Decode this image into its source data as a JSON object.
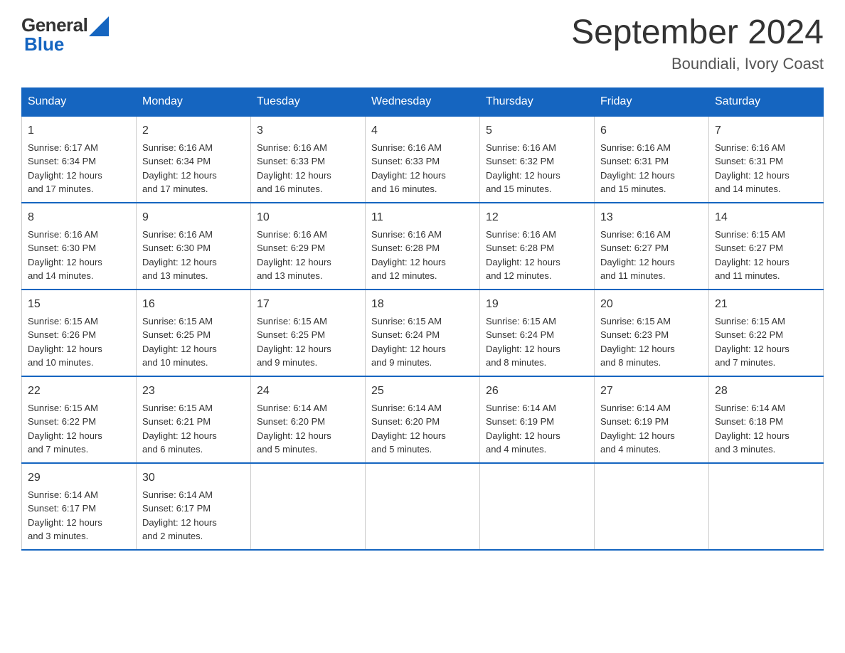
{
  "logo": {
    "general": "General",
    "blue": "Blue"
  },
  "title": "September 2024",
  "subtitle": "Boundiali, Ivory Coast",
  "days": [
    "Sunday",
    "Monday",
    "Tuesday",
    "Wednesday",
    "Thursday",
    "Friday",
    "Saturday"
  ],
  "weeks": [
    [
      {
        "day": "1",
        "sunrise": "6:17 AM",
        "sunset": "6:34 PM",
        "daylight": "12 hours and 17 minutes."
      },
      {
        "day": "2",
        "sunrise": "6:16 AM",
        "sunset": "6:34 PM",
        "daylight": "12 hours and 17 minutes."
      },
      {
        "day": "3",
        "sunrise": "6:16 AM",
        "sunset": "6:33 PM",
        "daylight": "12 hours and 16 minutes."
      },
      {
        "day": "4",
        "sunrise": "6:16 AM",
        "sunset": "6:33 PM",
        "daylight": "12 hours and 16 minutes."
      },
      {
        "day": "5",
        "sunrise": "6:16 AM",
        "sunset": "6:32 PM",
        "daylight": "12 hours and 15 minutes."
      },
      {
        "day": "6",
        "sunrise": "6:16 AM",
        "sunset": "6:31 PM",
        "daylight": "12 hours and 15 minutes."
      },
      {
        "day": "7",
        "sunrise": "6:16 AM",
        "sunset": "6:31 PM",
        "daylight": "12 hours and 14 minutes."
      }
    ],
    [
      {
        "day": "8",
        "sunrise": "6:16 AM",
        "sunset": "6:30 PM",
        "daylight": "12 hours and 14 minutes."
      },
      {
        "day": "9",
        "sunrise": "6:16 AM",
        "sunset": "6:30 PM",
        "daylight": "12 hours and 13 minutes."
      },
      {
        "day": "10",
        "sunrise": "6:16 AM",
        "sunset": "6:29 PM",
        "daylight": "12 hours and 13 minutes."
      },
      {
        "day": "11",
        "sunrise": "6:16 AM",
        "sunset": "6:28 PM",
        "daylight": "12 hours and 12 minutes."
      },
      {
        "day": "12",
        "sunrise": "6:16 AM",
        "sunset": "6:28 PM",
        "daylight": "12 hours and 12 minutes."
      },
      {
        "day": "13",
        "sunrise": "6:16 AM",
        "sunset": "6:27 PM",
        "daylight": "12 hours and 11 minutes."
      },
      {
        "day": "14",
        "sunrise": "6:15 AM",
        "sunset": "6:27 PM",
        "daylight": "12 hours and 11 minutes."
      }
    ],
    [
      {
        "day": "15",
        "sunrise": "6:15 AM",
        "sunset": "6:26 PM",
        "daylight": "12 hours and 10 minutes."
      },
      {
        "day": "16",
        "sunrise": "6:15 AM",
        "sunset": "6:25 PM",
        "daylight": "12 hours and 10 minutes."
      },
      {
        "day": "17",
        "sunrise": "6:15 AM",
        "sunset": "6:25 PM",
        "daylight": "12 hours and 9 minutes."
      },
      {
        "day": "18",
        "sunrise": "6:15 AM",
        "sunset": "6:24 PM",
        "daylight": "12 hours and 9 minutes."
      },
      {
        "day": "19",
        "sunrise": "6:15 AM",
        "sunset": "6:24 PM",
        "daylight": "12 hours and 8 minutes."
      },
      {
        "day": "20",
        "sunrise": "6:15 AM",
        "sunset": "6:23 PM",
        "daylight": "12 hours and 8 minutes."
      },
      {
        "day": "21",
        "sunrise": "6:15 AM",
        "sunset": "6:22 PM",
        "daylight": "12 hours and 7 minutes."
      }
    ],
    [
      {
        "day": "22",
        "sunrise": "6:15 AM",
        "sunset": "6:22 PM",
        "daylight": "12 hours and 7 minutes."
      },
      {
        "day": "23",
        "sunrise": "6:15 AM",
        "sunset": "6:21 PM",
        "daylight": "12 hours and 6 minutes."
      },
      {
        "day": "24",
        "sunrise": "6:14 AM",
        "sunset": "6:20 PM",
        "daylight": "12 hours and 5 minutes."
      },
      {
        "day": "25",
        "sunrise": "6:14 AM",
        "sunset": "6:20 PM",
        "daylight": "12 hours and 5 minutes."
      },
      {
        "day": "26",
        "sunrise": "6:14 AM",
        "sunset": "6:19 PM",
        "daylight": "12 hours and 4 minutes."
      },
      {
        "day": "27",
        "sunrise": "6:14 AM",
        "sunset": "6:19 PM",
        "daylight": "12 hours and 4 minutes."
      },
      {
        "day": "28",
        "sunrise": "6:14 AM",
        "sunset": "6:18 PM",
        "daylight": "12 hours and 3 minutes."
      }
    ],
    [
      {
        "day": "29",
        "sunrise": "6:14 AM",
        "sunset": "6:17 PM",
        "daylight": "12 hours and 3 minutes."
      },
      {
        "day": "30",
        "sunrise": "6:14 AM",
        "sunset": "6:17 PM",
        "daylight": "12 hours and 2 minutes."
      },
      null,
      null,
      null,
      null,
      null
    ]
  ]
}
